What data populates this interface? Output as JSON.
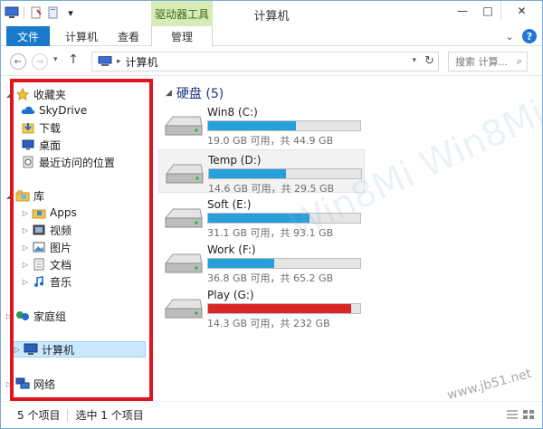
{
  "window": {
    "title": "计算机",
    "context_tab_group": "驱动器工具"
  },
  "ribbon": {
    "tabs": [
      "文件",
      "计算机",
      "查看",
      "管理"
    ]
  },
  "address": {
    "path": "计算机",
    "search_placeholder": "搜索 计算..."
  },
  "nav_pane": {
    "items": [
      {
        "label": "收藏夹",
        "icon": "star-icon"
      },
      {
        "label": "SkyDrive",
        "icon": "cloud-icon"
      },
      {
        "label": "下载",
        "icon": "download-folder-icon"
      },
      {
        "label": "桌面",
        "icon": "desktop-icon"
      },
      {
        "label": "最近访问的位置",
        "icon": "recent-places-icon"
      },
      {
        "label": "库",
        "icon": "libraries-icon"
      },
      {
        "label": "Apps",
        "icon": "apps-folder-icon"
      },
      {
        "label": "视频",
        "icon": "video-icon"
      },
      {
        "label": "图片",
        "icon": "pictures-icon"
      },
      {
        "label": "文档",
        "icon": "documents-icon"
      },
      {
        "label": "音乐",
        "icon": "music-icon"
      },
      {
        "label": "家庭组",
        "icon": "homegroup-icon"
      },
      {
        "label": "计算机",
        "icon": "computer-icon"
      },
      {
        "label": "网络",
        "icon": "network-icon"
      }
    ]
  },
  "content": {
    "group_label": "硬盘 (5)",
    "drives": [
      {
        "name": "Win8 (C:)",
        "free_text": "19.0 GB 可用，共 44.9 GB",
        "used_fraction": 0.577,
        "status": "normal"
      },
      {
        "name": "Temp (D:)",
        "free_text": "14.6 GB 可用，共 29.5 GB",
        "used_fraction": 0.505,
        "status": "normal"
      },
      {
        "name": "Soft (E:)",
        "free_text": "31.1 GB 可用，共 93.1 GB",
        "used_fraction": 0.666,
        "status": "normal"
      },
      {
        "name": "Work (F:)",
        "free_text": "36.8 GB 可用，共 65.2 GB",
        "used_fraction": 0.436,
        "status": "normal"
      },
      {
        "name": "Play (G:)",
        "free_text": "14.3 GB 可用，共 232 GB",
        "used_fraction": 0.938,
        "status": "full"
      }
    ]
  },
  "status": {
    "item_count": "5 个项目",
    "selected": "选中 1 个项目"
  },
  "watermark": {
    "text": "Win8Mi Win8Mi Win8Mi",
    "url": "www.jb51.net"
  },
  "colors": {
    "accent": "#1979ca",
    "bar_normal": "#26a0da",
    "bar_full": "#da2626",
    "highlight_frame": "#e0141e"
  }
}
